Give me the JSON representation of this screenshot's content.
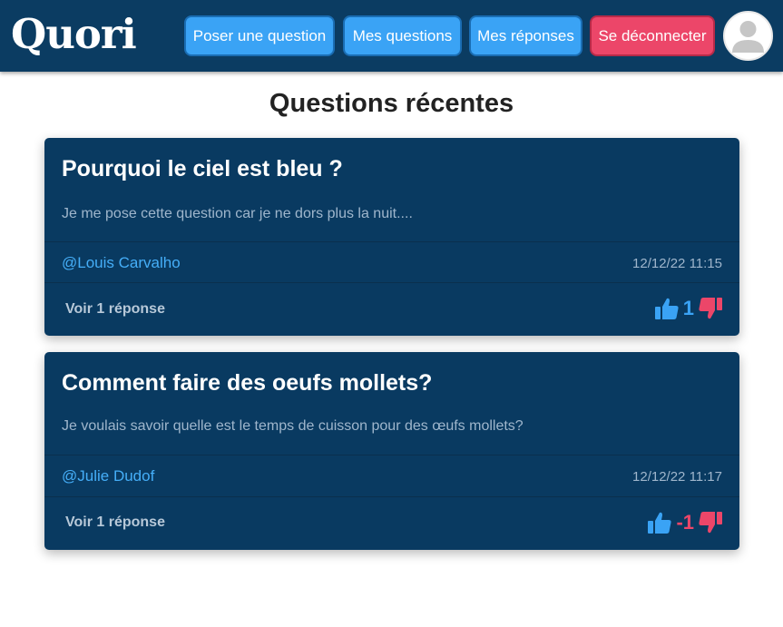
{
  "app": {
    "logo": "Quori"
  },
  "nav": {
    "ask_label": "Poser une question",
    "my_questions_label": "Mes questions",
    "my_answers_label": "Mes réponses",
    "logout_label": "Se déconnecter"
  },
  "main": {
    "title": "Questions récentes",
    "questions": [
      {
        "title": "Pourquoi le ciel est bleu ?",
        "body": "Je me pose cette question car je ne dors plus la nuit....",
        "author": "@Louis Carvalho",
        "date": "12/12/22 11:15",
        "answers_label": "Voir 1 réponse",
        "score": "1"
      },
      {
        "title": "Comment faire des oeufs mollets?",
        "body": "Je voulais savoir quelle est le temps de cuisson pour des œufs mollets?",
        "author": "@Julie Dudof",
        "date": "12/12/22 11:17",
        "answers_label": "Voir 1 réponse",
        "score": "-1"
      }
    ]
  },
  "colors": {
    "navbar": "#0b3c62",
    "card": "#093a61",
    "primary_button": "#3aa3f5",
    "danger_button": "#ec4669",
    "author_link": "#45aef8",
    "upvote": "#3aa3f5",
    "downvote": "#ec4669"
  },
  "icons": {
    "upvote": "thumbs-up-icon",
    "downvote": "thumbs-down-icon",
    "avatar": "user-avatar-icon"
  }
}
